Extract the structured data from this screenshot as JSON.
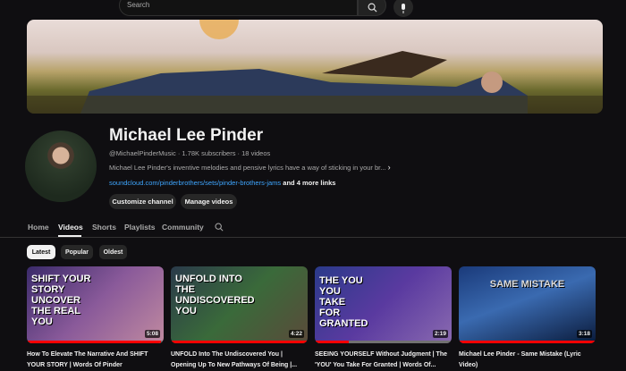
{
  "header": {
    "search_placeholder": "Search"
  },
  "channel": {
    "name": "Michael Lee Pinder",
    "handle": "@MichaelPinderMusic",
    "subscribers": "1.78K subscribers",
    "videos": "18 videos",
    "separator": "·",
    "description": "Michael Lee Pinder's inventive melodies and pensive lyrics have a way of sticking in your br...",
    "link": "soundcloud.com/pinderbrothers/sets/pinder-brothers-jams",
    "more_links": "and 4 more links",
    "customize": "Customize channel",
    "manage": "Manage videos"
  },
  "tabs": [
    "Home",
    "Videos",
    "Shorts",
    "Playlists",
    "Community"
  ],
  "chips": [
    "Latest",
    "Popular",
    "Oldest"
  ],
  "videos": [
    {
      "thumb_text": "SHIFT YOUR STORY UNCOVER THE REAL YOU",
      "duration": "5:08",
      "progress": 0.98,
      "title": "How To Elevate The Narrative And SHIFT YOUR STORY | Words Of Pinder"
    },
    {
      "thumb_text": "UNFOLD INTO THE UNDISCOVERED YOU",
      "duration": "4:22",
      "progress": 1.0,
      "title": "UNFOLD Into The Undiscovered You | Opening Up To New Pathways Of Being |..."
    },
    {
      "thumb_text": "THE YOU YOU TAKE FOR GRANTED",
      "duration": "2:19",
      "progress": 0.25,
      "title": "SEEING YOURSELF Without Judgment | The 'YOU' You Take For Granted | Words Of..."
    },
    {
      "thumb_text": "SAME MISTAKE",
      "duration": "3:18",
      "progress": 1.0,
      "title": "Michael Lee Pinder - Same Mistake (Lyric Video)"
    }
  ]
}
